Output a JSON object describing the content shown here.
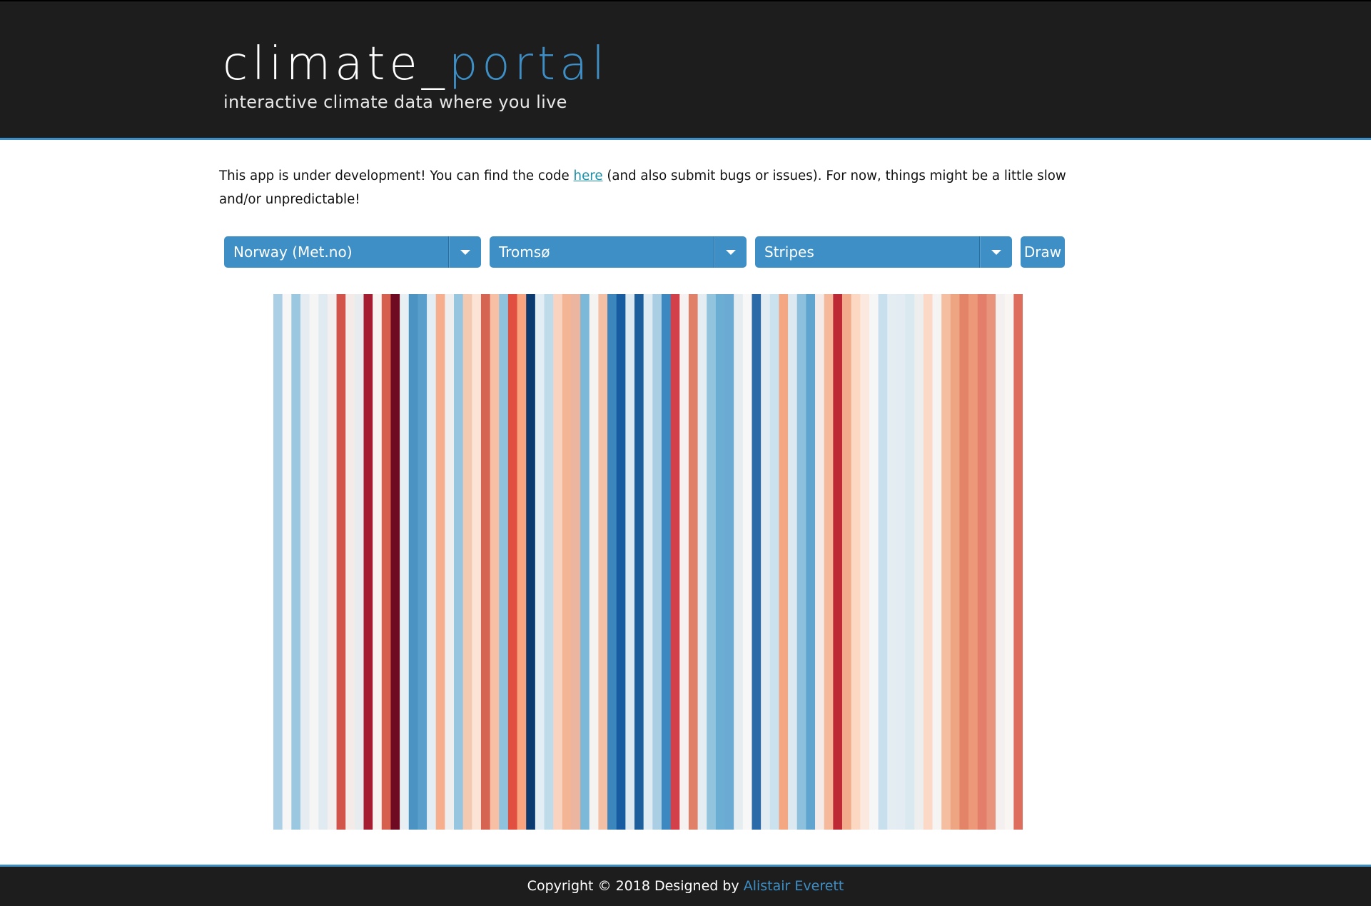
{
  "header": {
    "logo_main": "climate_",
    "logo_accent": "portal",
    "tagline": "interactive climate data where you live"
  },
  "notice": {
    "text_before": "This app is under development! You can find the code ",
    "link_text": "here",
    "text_after": " (and also submit bugs or issues). For now, things might be a little slow and/or unpredictable!"
  },
  "controls": {
    "source": {
      "selected": "Norway (Met.no)"
    },
    "location": {
      "selected": "Tromsø"
    },
    "chart_type": {
      "selected": "Stripes"
    },
    "draw_label": "Draw"
  },
  "colors": {
    "accent": "#3d8fc6",
    "header_bg": "#1d1d1d",
    "link": "#1a8fa8"
  },
  "chart_data": {
    "type": "heatmap",
    "title": "",
    "colormap": "RdBu_r",
    "stripe_colors": [
      "#abcfe5",
      "#f7f6f6",
      "#9ac8e0",
      "#e6edf2",
      "#f5f5f5",
      "#e0ebf1",
      "#f2efee",
      "#d1534a",
      "#f4ebe8",
      "#e9ecee",
      "#a51d30",
      "#f8f4f2",
      "#d6604d",
      "#6e0b22",
      "#e9f0f4",
      "#4b93c3",
      "#5a9fcb",
      "#e3eef4",
      "#f6ae8d",
      "#eeeeee",
      "#96c5df",
      "#f3c9b2",
      "#fbe3d6",
      "#d66452",
      "#f7c0a4",
      "#8fc2dd",
      "#e04f3f",
      "#f9a37f",
      "#0b3a70",
      "#e3eef4",
      "#bedbea",
      "#f9d3c0",
      "#f3b596",
      "#ebb5a0",
      "#7cb8d8",
      "#f4f3f2",
      "#f4c0a5",
      "#3a86bd",
      "#175ba0",
      "#dce9f1",
      "#1d5f9d",
      "#e0ecf3",
      "#aacfe4",
      "#3b89c0",
      "#d2414a",
      "#f6f2f1",
      "#e08068",
      "#e4edf2",
      "#92c4de",
      "#6baed4",
      "#6aaad3",
      "#e6edf1",
      "#f7f7f7",
      "#2a6aa8",
      "#e2edf3",
      "#c9e2ee",
      "#f3a783",
      "#dce9f0",
      "#8cc0dd",
      "#5fa5d0",
      "#f4ebe8",
      "#f5b89b",
      "#bd2a35",
      "#f3ac8b",
      "#fcd8c3",
      "#fbe8df",
      "#f6f6f6",
      "#c8e0ee",
      "#e4edf2",
      "#e2ecf2",
      "#dae8f0",
      "#eeeeee",
      "#fbd9c6",
      "#f6f4f3",
      "#f6bea1",
      "#eda582",
      "#e38368",
      "#ee987a",
      "#e27e6a",
      "#e8937b",
      "#f3f0ef",
      "#f9f5f3",
      "#df6d5d"
    ]
  },
  "footer": {
    "text": "Copyright © 2018 Designed by ",
    "author": "Alistair Everett"
  }
}
